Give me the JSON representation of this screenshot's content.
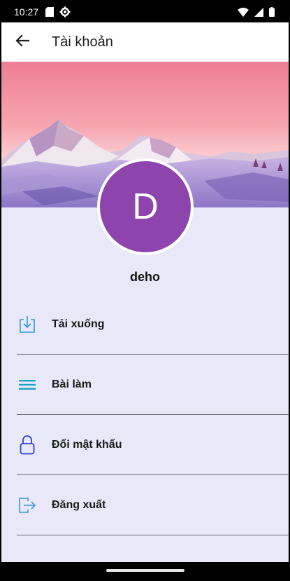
{
  "status_bar": {
    "time": "10:27",
    "left_icons": [
      "sd-card-icon",
      "settings-gear-icon"
    ],
    "right_icons": [
      "wifi-icon",
      "cellular-signal-icon",
      "battery-icon"
    ]
  },
  "app_bar": {
    "back_icon": "arrow-back-icon",
    "title": "Tài khoản"
  },
  "profile": {
    "avatar_letter": "D",
    "avatar_color": "#8e44ad",
    "username": "deho"
  },
  "menu": {
    "items": [
      {
        "label": "Tải xuống",
        "icon": "download-icon",
        "icon_color": "#2f9bd8"
      },
      {
        "label": "Bài làm",
        "icon": "list-lines-icon",
        "icon_color": "#1aa6c4"
      },
      {
        "label": "Đổi mật khẩu",
        "icon": "lock-icon",
        "icon_color": "#2b3fd6"
      },
      {
        "label": "Đăng xuất",
        "icon": "logout-icon",
        "icon_color": "#3a96e0"
      }
    ]
  },
  "colors": {
    "background": "#e9e8f8",
    "divider": "#6e6e74"
  }
}
